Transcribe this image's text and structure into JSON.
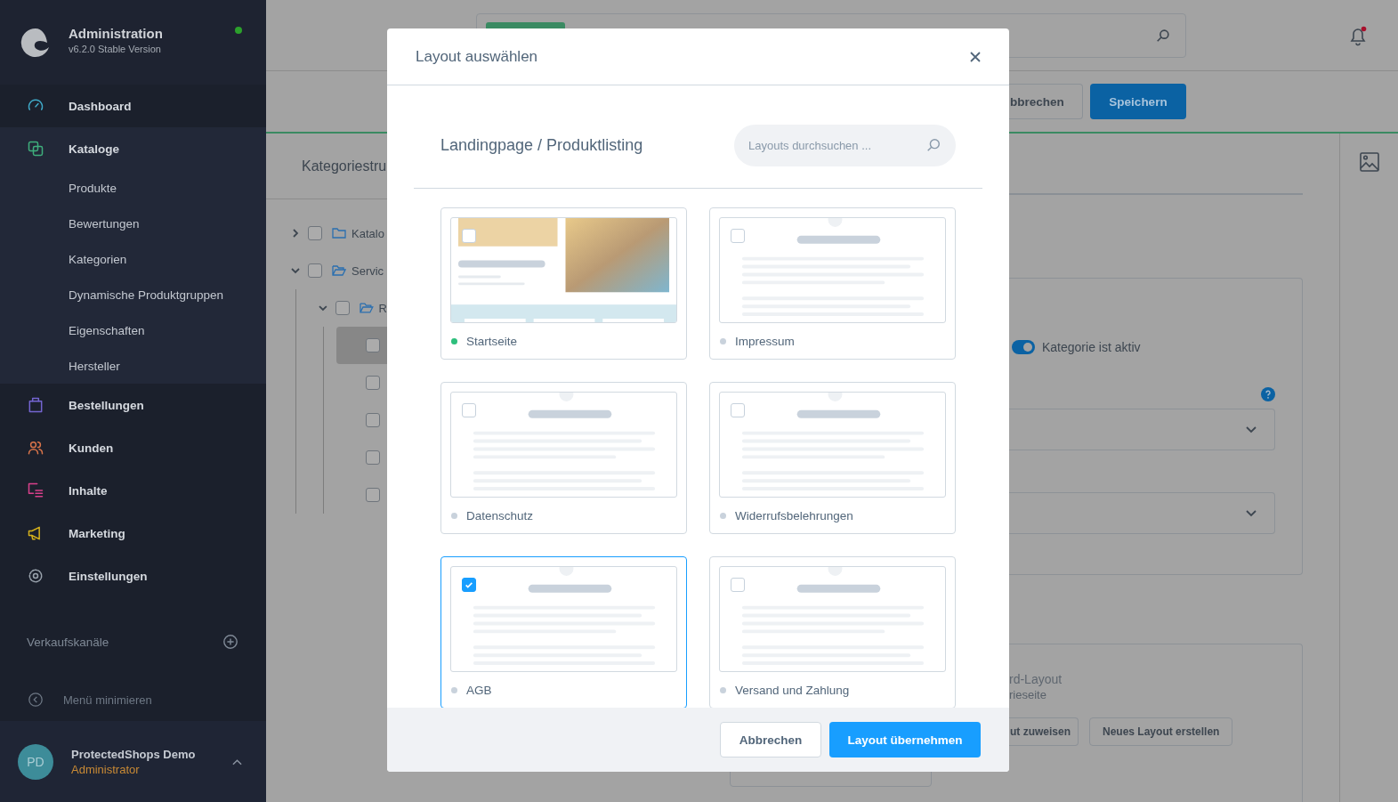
{
  "sidebar": {
    "title": "Administration",
    "version": "v6.2.0 Stable Version",
    "online": true,
    "nav": [
      {
        "label": "Dashboard",
        "color": "#3fa9c8",
        "expanded": false
      },
      {
        "label": "Kataloge",
        "color": "#3fae7c",
        "expanded": true,
        "children": [
          {
            "label": "Produkte"
          },
          {
            "label": "Bewertungen"
          },
          {
            "label": "Kategorien"
          },
          {
            "label": "Dynamische Produktgruppen"
          },
          {
            "label": "Eigenschaften"
          },
          {
            "label": "Hersteller"
          }
        ]
      },
      {
        "label": "Bestellungen",
        "color": "#7465d1",
        "expanded": false
      },
      {
        "label": "Kunden",
        "color": "#d9744a",
        "expanded": false
      },
      {
        "label": "Inhalte",
        "color": "#d9408b",
        "expanded": false
      },
      {
        "label": "Marketing",
        "color": "#d4b01c",
        "expanded": false
      },
      {
        "label": "Einstellungen",
        "color": "#9aa3ad",
        "expanded": false
      }
    ],
    "sales_channels": {
      "label": "Verkaufskanäle"
    },
    "collapse": {
      "label": "Menü minimieren"
    },
    "user": {
      "initials": "PD",
      "name": "ProtectedShops Demo",
      "role": "Administrator"
    }
  },
  "header": {
    "notifications_unread": true
  },
  "actions": [
    {
      "label": "bbrechen",
      "kind": "secondary"
    },
    {
      "label": "Speichern",
      "kind": "primary"
    }
  ],
  "tab_title": "Kategoriestru",
  "tree": [
    {
      "label": "Katalo",
      "checked": false,
      "expanded": false
    },
    {
      "label": "Servic",
      "checked": false,
      "expanded": true,
      "children": [
        {
          "label": "R",
          "checked": false,
          "expanded": true,
          "children": [
            {
              "checked": false,
              "selected": true
            },
            {
              "checked": false,
              "selected": false
            },
            {
              "checked": false,
              "selected": false
            },
            {
              "checked": false,
              "selected": false
            },
            {
              "checked": false,
              "selected": false
            }
          ]
        }
      ]
    }
  ],
  "settings": {
    "active": {
      "label": "Kategorie ist aktiv",
      "on": true
    }
  },
  "layout_card": {
    "lines": [
      "rd-Layout",
      "rieseite"
    ],
    "buttons": [
      "ut zuweisen",
      "Neues Layout erstellen"
    ]
  },
  "modal": {
    "title": "Layout auswählen",
    "heading": "Landingpage / Produktlisting",
    "search": {
      "placeholder": "Layouts durchsuchen ..."
    },
    "layouts": [
      {
        "name": "Startseite",
        "kind": "listing",
        "color": "#2dbf7c",
        "selected": false
      },
      {
        "name": "Impressum",
        "kind": "text",
        "color": "#c9d2dc",
        "selected": false
      },
      {
        "name": "Datenschutz",
        "kind": "text",
        "color": "#c9d2dc",
        "selected": false
      },
      {
        "name": "Widerrufsbelehrungen",
        "kind": "text",
        "color": "#c9d2dc",
        "selected": false
      },
      {
        "name": "AGB",
        "kind": "text",
        "color": "#c9d2dc",
        "selected": true
      },
      {
        "name": "Versand und Zahlung",
        "kind": "text",
        "color": "#c9d2dc",
        "selected": false
      }
    ],
    "buttons": [
      {
        "label": "Abbrechen",
        "kind": "secondary"
      },
      {
        "label": "Layout übernehmen",
        "kind": "primary"
      }
    ]
  }
}
